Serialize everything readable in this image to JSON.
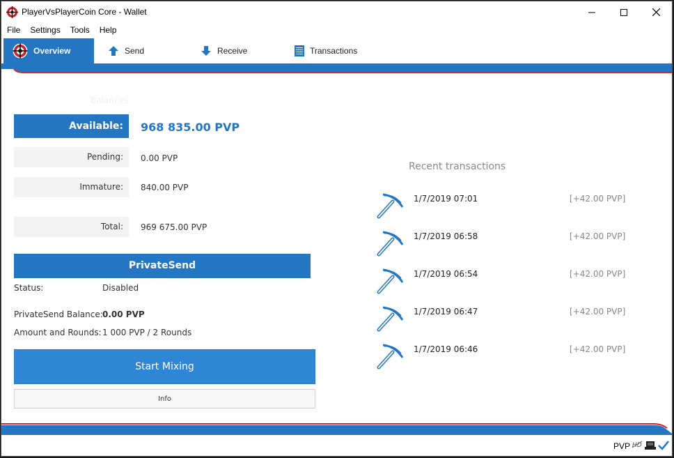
{
  "window": {
    "title": "PlayerVsPlayerCoin Core - Wallet",
    "icon": "app-logo-icon"
  },
  "menu": {
    "items": [
      "File",
      "Settings",
      "Tools",
      "Help"
    ]
  },
  "toolbar": {
    "tabs": [
      {
        "label": "Overview",
        "icon": "overview-icon",
        "active": true
      },
      {
        "label": "Send",
        "icon": "arrow-up-icon"
      },
      {
        "label": "Receive",
        "icon": "arrow-down-icon"
      },
      {
        "label": "Transactions",
        "icon": "list-icon"
      }
    ]
  },
  "balances": {
    "heading": "Balances",
    "available_label": "Available:",
    "available_value": "968 835.00 PVP",
    "pending_label": "Pending:",
    "pending_value": "0.00 PVP",
    "immature_label": "Immature:",
    "immature_value": "840.00 PVP",
    "total_label": "Total:",
    "total_value": "969 675.00 PVP"
  },
  "privatesend": {
    "title": "PrivateSend",
    "status_label": "Status:",
    "status_value": "Disabled",
    "balance_label": "PrivateSend Balance:",
    "balance_value": "0.00 PVP",
    "rounds_label": "Amount and Rounds:",
    "rounds_value": "1 000 PVP / 2 Rounds",
    "start_button": "Start Mixing",
    "info_button": "Info"
  },
  "recent": {
    "heading": "Recent transactions",
    "items": [
      {
        "date": "1/7/2019 07:01",
        "amount": "[+42.00 PVP]"
      },
      {
        "date": "1/7/2019 06:58",
        "amount": "[+42.00 PVP]"
      },
      {
        "date": "1/7/2019 06:54",
        "amount": "[+42.00 PVP]"
      },
      {
        "date": "1/7/2019 06:47",
        "amount": "[+42.00 PVP]"
      },
      {
        "date": "1/7/2019 06:46",
        "amount": "[+42.00 PVP]"
      }
    ]
  },
  "statusbar": {
    "unit": "PVP"
  },
  "colors": {
    "accent": "#2476c3",
    "stripe_red": "#d9232e"
  }
}
